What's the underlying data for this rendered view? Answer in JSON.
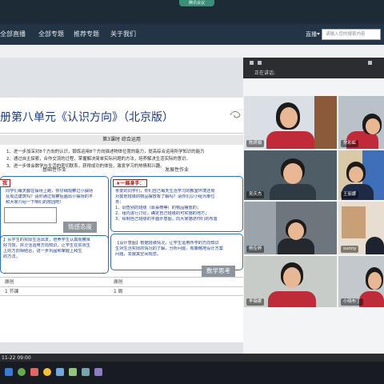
{
  "meeting": {
    "pill": "腾讯会议"
  },
  "nav": {
    "items": [
      "全部直播",
      "全部专题",
      "推荐专题",
      "关于我们"
    ],
    "live_label": "直播",
    "search_placeholder": "请输入您的搜索内容"
  },
  "slide": {
    "title": "册第八单元《认识方向》（北京版）",
    "subtitle": "第3课时 综合运用",
    "objectives": [
      "1、进一步加深对8个方向的认识，锻炼运用8个方向描述物体位置的能力，提高综合运用所学知识的能力",
      "2、通过自主探索，合作交流的过程，掌握解决简单实际问题的方法，培养解决生活实际的意识。",
      "3、进一步体会数学与生活的密切联系，获得成功的体验，激发学习的热情和兴趣。"
    ],
    "col_left": "基础性作业",
    "col_right": "发展性作业",
    "left_tag": "我",
    "left_lines": [
      "同学们每天都在操场上跑，你仔细观察过小操场",
      "及周边建筑吗？请你通过观察后画出小操场的平",
      "和大家介绍一下咱们的校园吧！"
    ],
    "emotion_tag": "情感态度",
    "left_design": [
      "】从学生的实际生活出发，培养学生认真观察良",
      "好习惯，并灵活运用方向知识，让学生在实际生",
      "上的方向相结合，进一步巩固和掌握上和生",
      "的方法。"
    ],
    "right_tag": "★一展身手：",
    "right_lines": [
      "亲爱的同学们，你们自己每天生活学习的教室环境还有",
      "对其他班级的物品摆放有了解吗？请你们以小组为单位",
      "务：",
      "1、调查别的班级（靠桌椅等）的物品摆放的；",
      "2、组内进行讨论，确定自己班级的可实施的地方；",
      "3、绘制自己班级的平面示意图，向大家描述你们的布置"
    ],
    "right_design": [
      "【设计意图】根据班级情况，让学生运用所学的方向知识",
      "生对生活实际的情况的了解，分析问题，有策略地设计方案",
      "问题，发展其空间观念。"
    ],
    "math_tag": "数学思考",
    "table": {
      "col1": "原创",
      "col2": "原创",
      "col1_val": "1 节课",
      "col2_val": "1 周"
    }
  },
  "video": {
    "talking_label": "正在讲话:",
    "participants": [
      "陈妍娟",
      "常彩虹",
      "吴庆杰",
      "王丽娜",
      "杨佳婷",
      "sunny",
      "李薇娜",
      "小晓布丁"
    ]
  },
  "status": {
    "timestamp": "11-22 09:00"
  },
  "colors": {
    "accent_blue": "#1a3b8a",
    "tag_red": "#b01515",
    "nav_bg": "#243447"
  }
}
